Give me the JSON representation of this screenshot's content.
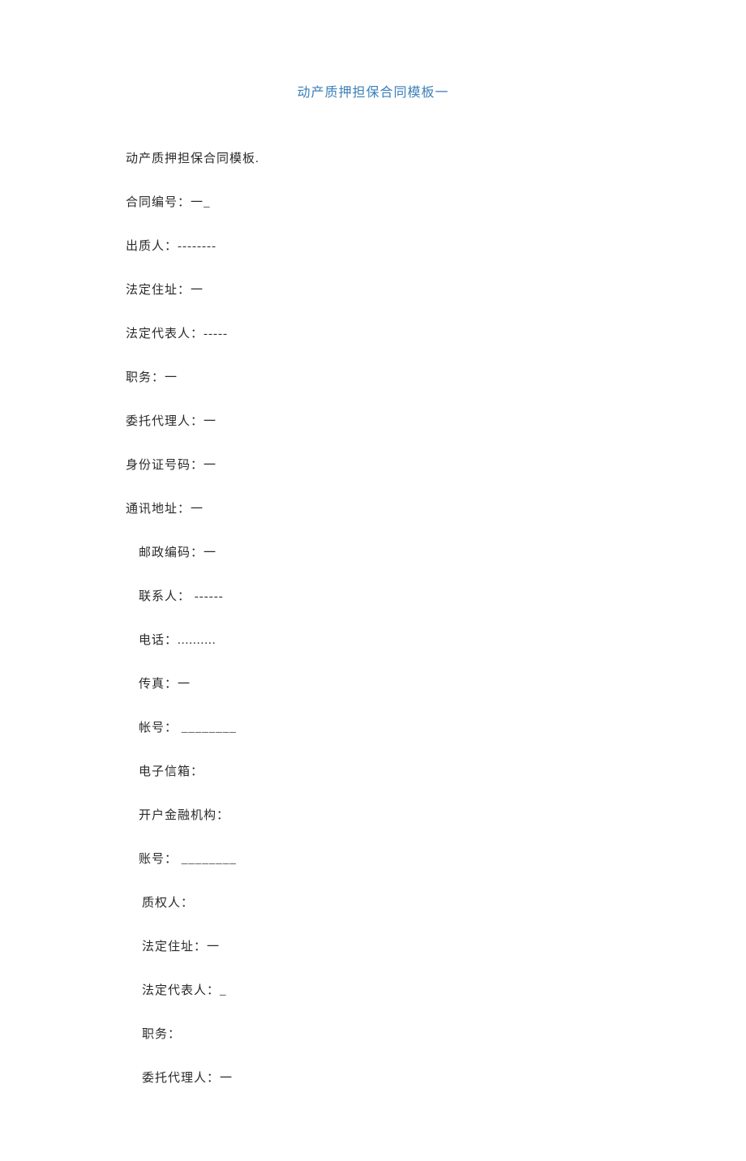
{
  "title": "动产质押担保合同模板一",
  "subtitle": "动产质押担保合同模板.",
  "fields": {
    "contract_number": "合同编号：一_",
    "pledgor": "出质人：--------",
    "legal_address": "法定住址：一",
    "legal_representative": "法定代表人：-----",
    "position": "职务：一",
    "agent": "委托代理人：一",
    "id_number": "身份证号码：一",
    "mailing_address": "通讯地址：一",
    "postal_code": "邮政编码：一",
    "contact_person": "联系人： ------",
    "phone": "电话：..........",
    "fax": "传真：一",
    "account": "帐号： ________",
    "email": "电子信箱：",
    "financial_institution": "开户金融机构：",
    "account2": "账号： ________",
    "pledgee": "质权人：",
    "legal_address2": "法定住址：一",
    "legal_representative2": "法定代表人：_",
    "position2": "职务：",
    "agent2": "委托代理人：一"
  }
}
